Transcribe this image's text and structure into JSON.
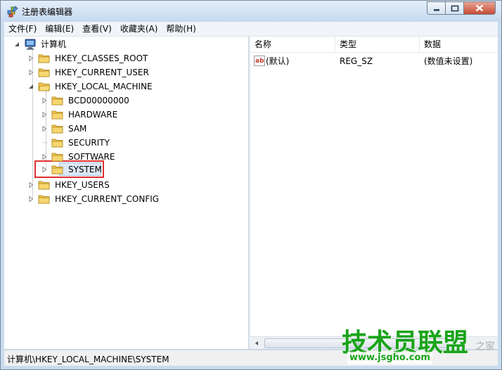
{
  "window": {
    "title": "注册表编辑器"
  },
  "menu": [
    "文件(F)",
    "编辑(E)",
    "查看(V)",
    "收藏夹(A)",
    "帮助(H)"
  ],
  "tree": {
    "root": "计算机",
    "hives": [
      "HKEY_CLASSES_ROOT",
      "HKEY_CURRENT_USER",
      "HKEY_LOCAL_MACHINE"
    ],
    "hklm_children": [
      "BCD00000000",
      "HARDWARE",
      "SAM",
      "SECURITY",
      "SOFTWARE",
      "SYSTEM"
    ],
    "more_hives": [
      "HKEY_USERS",
      "HKEY_CURRENT_CONFIG"
    ],
    "selected": "SYSTEM"
  },
  "list": {
    "columns": [
      "名称",
      "类型",
      "数据"
    ],
    "rows": [
      {
        "name": "(默认)",
        "type": "REG_SZ",
        "data": "(数值未设置)"
      }
    ]
  },
  "status": {
    "path": "计算机\\HKEY_LOCAL_MACHINE\\SYSTEM"
  },
  "watermark": {
    "main": "技术员联盟",
    "url": "www.jsgho.com",
    "side": "之家"
  },
  "colors": {
    "highlight_box": "#e03030",
    "folder": "#f3c74e",
    "watermark": "#1aa31a"
  }
}
